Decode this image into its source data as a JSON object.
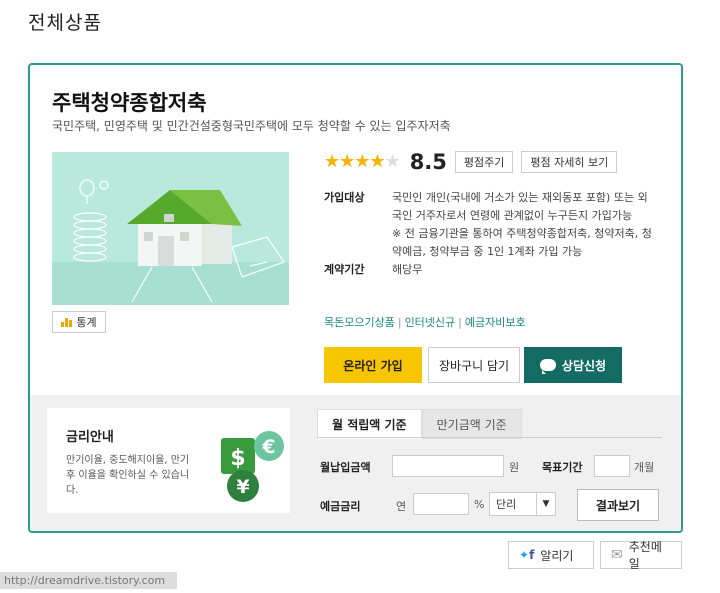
{
  "page": {
    "title": "전체상품"
  },
  "product": {
    "name": "주택청약종합저축",
    "description": "국민주택, 민영주택 및 민간건설중형국민주택에 모두 청약할 수 있는 입주자저축",
    "rating": {
      "score": "8.5",
      "stars_filled_fraction": 0.8,
      "rate_button": "평점주기",
      "detail_button": "평점 자세히 보기"
    },
    "stats_button": "통계",
    "eligibility_label": "가입대상",
    "eligibility_text": "국민인 개인(국내에 거소가 있는 재외동포 포함) 또는 외국인 거주자로서 연령에 관계없이 누구든지 가입가능",
    "eligibility_note": "※ 전 금융기관을 통하여 주택청약종합저축, 청약저축, 청약예금, 청약부금 중 1인 1계좌 가입 가능",
    "term_label": "계약기간",
    "term_value": "해당무",
    "links": [
      "목돈모으기상품",
      "인터넷신규",
      "예금자비보호"
    ],
    "buttons": {
      "online": "온라인 가입",
      "cart": "장바구니 담기",
      "consult": "상담신청"
    }
  },
  "rate_guide": {
    "title": "금리안내",
    "description": "만기이율, 중도해지이율, 만기후 이율을 확인하실 수 있습니다."
  },
  "calculator": {
    "tabs": [
      "월 적립액 기준",
      "만기금액 기준"
    ],
    "monthly_label": "월납입금액",
    "monthly_unit": "원",
    "target_label": "목표기간",
    "target_unit": "개월",
    "rate_label": "예금금리",
    "rate_prefix": "연",
    "rate_unit": "%",
    "interest_type": "단리",
    "result_button": "결과보기"
  },
  "share": {
    "share_label": "알리기",
    "email_label": "추천메일"
  },
  "watermark": "http://dreamdrive.tistory.com",
  "colors": {
    "teal": "#2a9d8f",
    "yellow": "#f7c600",
    "dark_teal": "#136b63",
    "star": "#f5b400"
  }
}
